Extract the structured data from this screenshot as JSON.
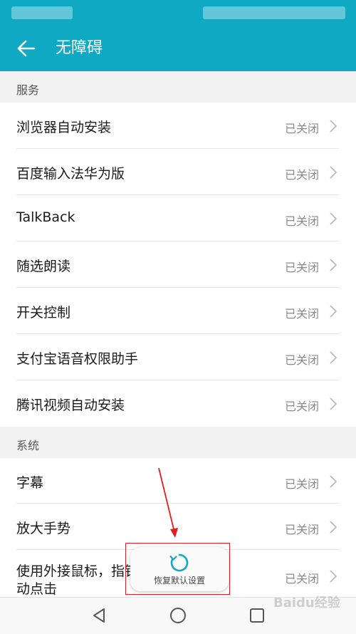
{
  "header": {
    "title": "无障碍"
  },
  "sections": [
    {
      "title": "服务"
    },
    {
      "title": "系统"
    }
  ],
  "service_items": [
    {
      "label": "浏览器自动安装",
      "status": "已关闭"
    },
    {
      "label": "百度输入法华为版",
      "status": "已关闭"
    },
    {
      "label": "TalkBack",
      "status": "已关闭"
    },
    {
      "label": "随选朗读",
      "status": "已关闭"
    },
    {
      "label": "开关控制",
      "status": "已关闭"
    },
    {
      "label": "支付宝语音权限助手",
      "status": "已关闭"
    },
    {
      "label": "腾讯视频自动安装",
      "status": "已关闭"
    }
  ],
  "system_items": [
    {
      "label": "字幕",
      "status": "已关闭"
    },
    {
      "label": "放大手势",
      "status": "已关闭"
    },
    {
      "label_line1": "使用外接鼠标，指针停止移动后自",
      "label_line2": "动点击",
      "status": "已关闭"
    }
  ],
  "toast": {
    "message": "恢复默认设置"
  },
  "watermark": "Baidu经验",
  "colors": {
    "accent": "#0fa9c4",
    "annotation": "#e02020"
  },
  "icons": {
    "back": "arrow-left-icon",
    "chevron": "chevron-right-icon",
    "spinner": "refresh-icon"
  }
}
